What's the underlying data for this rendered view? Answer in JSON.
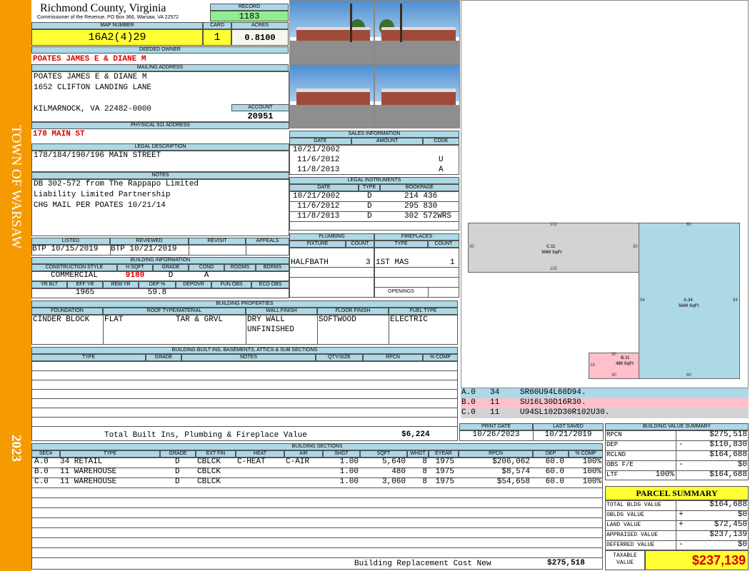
{
  "sidebar": {
    "town": "TOWN OF WARSAW",
    "year": "2023"
  },
  "header": {
    "county": "Richmond County, Virginia",
    "commissioner": "Commissioner of the Revenue, PO Box 366, Warsaw, VA 22572",
    "record_label": "RECORD",
    "record": "1183",
    "map_number_label": "MAP NUMBER",
    "map_number": "16A2(4)29",
    "card_label": "CARD",
    "card": "1",
    "acres_label": "ACRES",
    "acres": "0.8100"
  },
  "owner": {
    "label": "DEEDED OWNER",
    "name": "POATES JAMES E & DIANE M"
  },
  "mailing": {
    "label": "MAILING ADDRESS",
    "line1": "POATES JAMES E & DIANE M",
    "line2": "1652 CLIFTON LANDING LANE",
    "line3": "KILMARNOCK, VA 22482-0000",
    "account_label": "ACCOUNT",
    "account": "20951"
  },
  "physical": {
    "label": "PHYSICAL 911 ADDRESS",
    "address": "178 MAIN ST"
  },
  "legal": {
    "label": "LEGAL DESCRIPTION",
    "text": "178/184/190/196 MAIN STREET"
  },
  "notes": {
    "label": "NOTES",
    "line1": "DB 302-572 from The Rappapo Limited",
    "line2": "Liability Limited Partnership",
    "line3": "CHG MAIL PER POATES 10/21/14"
  },
  "review": {
    "listed_label": "LISTED",
    "listed": "BTP 10/15/2019",
    "reviewed_label": "REVIEWED",
    "reviewed": "BTP 10/21/2019",
    "revisit_label": "REVISIT",
    "revisit": "",
    "appeals_label": "APPEALS",
    "appeals": ""
  },
  "building_info": {
    "label": "BUILDING INFORMATION",
    "construction_style_label": "CONSTRUCTION STYLE",
    "construction_style": "COMMERCIAL",
    "h_sqft_label": "H SQFT",
    "h_sqft": "9180",
    "grade_label": "GRADE",
    "grade": "D",
    "cond_label": "COND",
    "cond": "A",
    "rooms_label": "ROOMS",
    "rooms": "",
    "bdrms_label": "BDRMS",
    "bdrms": "",
    "yr_blt_label": "YR BLT",
    "yr_blt": "",
    "eff_yr_label": "EFF YR",
    "eff_yr": "1965",
    "rem_yr_label": "REM YR",
    "rem_yr": "",
    "dep_pct_label": "DEP %",
    "dep_pct": "59.8",
    "depovr_label": "DEPOVR",
    "depovr": "",
    "fun_obs_label": "FUN OBS",
    "fun_obs": "",
    "eco_obs_label": "ECO OBS",
    "eco_obs": ""
  },
  "sales": {
    "label": "SALES INFORMATION",
    "cols": [
      "DATE",
      "AMOUNT",
      "CODE"
    ],
    "rows": [
      {
        "date": "10/21/2002",
        "amount": "",
        "code": ""
      },
      {
        "date": "11/6/2012",
        "amount": "",
        "code": "U"
      },
      {
        "date": "11/8/2013",
        "amount": "",
        "code": "A"
      }
    ]
  },
  "instruments": {
    "label": "LEGAL INSTRUMENTS",
    "cols": [
      "DATE",
      "TYPE",
      "BOOKPAGE"
    ],
    "rows": [
      {
        "date": "10/21/2002",
        "type": "D",
        "bookpage": "214 436"
      },
      {
        "date": "11/6/2012",
        "type": "D",
        "bookpage": "295 830"
      },
      {
        "date": "11/8/2013",
        "type": "D",
        "bookpage": "302 572WRS"
      }
    ]
  },
  "plumbing": {
    "label": "PLUMBING",
    "fixture_label": "FIXTURE",
    "count_label": "COUNT",
    "fixture": "HALFBATH",
    "count": "3"
  },
  "fireplaces": {
    "label": "FIREPLACES",
    "type_label": "TYPE",
    "count_label": "COUNT",
    "type": "1ST MAS",
    "count": "1",
    "openings_label": "OPENINGS",
    "openings": ""
  },
  "building_properties": {
    "label": "BUILDING PROPERTIES",
    "foundation_label": "FOUNDATION",
    "foundation": "CINDER BLOCK",
    "roof_label": "ROOF TYPE/MATERIAL",
    "roof_type": "FLAT",
    "roof_material": "TAR & GRVL",
    "wall_label": "WALL FINISH",
    "wall1": "DRY WALL",
    "wall2": "UNFINISHED",
    "floor_label": "FLOOR FINISH",
    "floor": "SOFTWOOD",
    "fuel_label": "FUEL TYPE",
    "fuel": "ELECTRIC"
  },
  "built_ins": {
    "label": "BUILDING BUILT INS, BASEMENTS, ATTICS & SUB SECTIONS",
    "cols": [
      "TYPE",
      "GRADE",
      "NOTES",
      "QTY/SIZE",
      "RPCN",
      "% COMP"
    ],
    "total_label": "Total Built Ins, Plumbing & Fireplace Value",
    "total": "$6,224"
  },
  "sketch": {
    "c_label": "C.11",
    "c_area": "3060 SqFt",
    "a_label": "A.34",
    "a_area": "5640 SqFt",
    "b_label": "B.11",
    "b_area": "480 SqFt",
    "dim_102": "102",
    "dim_30": "30",
    "dim_60": "60",
    "dim_94": "94",
    "dim_16": "16"
  },
  "sketch_codes": [
    {
      "sec": "A.0",
      "code": "34",
      "path": "SR60U94L60D94.",
      "color": "#add8e6"
    },
    {
      "sec": "B.0",
      "code": "11",
      "path": "SU16L30D16R30.",
      "color": "#ffc0cb"
    },
    {
      "sec": "C.0",
      "code": "11",
      "path": "U94SL102D30R102U30.",
      "color": "#d3d3d3"
    }
  ],
  "print_info": {
    "print_label": "PRINT DATE",
    "print_date": "10/26/2023",
    "saved_label": "LAST SAVED",
    "saved_date": "10/21/2019"
  },
  "sections": {
    "label": "BUILDING SECTIONS",
    "cols": [
      "SEC#",
      "TYPE",
      "GRADE",
      "EXT FIN",
      "HEAT",
      "AIR",
      "SHGT",
      "SQFT",
      "WHGT",
      "EYEAR",
      "RPCN",
      "DEP",
      "% COMP"
    ],
    "rows": [
      {
        "sec": "A.0",
        "type": "34 RETAIL",
        "grade": "D",
        "ext": "CBLCK",
        "heat": "C-HEAT",
        "air": "C-AIR",
        "shgt": "1.00",
        "sqft": "5,640",
        "whgt": "8",
        "eyear": "1975",
        "rpcn": "$206,062",
        "dep": "60.0",
        "comp": "100%"
      },
      {
        "sec": "B.0",
        "type": "11 WAREHOUSE",
        "grade": "D",
        "ext": "CBLCK",
        "heat": "",
        "air": "",
        "shgt": "1.00",
        "sqft": "480",
        "whgt": "8",
        "eyear": "1975",
        "rpcn": "$8,574",
        "dep": "60.0",
        "comp": "100%"
      },
      {
        "sec": "C.0",
        "type": "11 WAREHOUSE",
        "grade": "D",
        "ext": "CBLCK",
        "heat": "",
        "air": "",
        "shgt": "1.00",
        "sqft": "3,060",
        "whgt": "8",
        "eyear": "1975",
        "rpcn": "$54,658",
        "dep": "60.0",
        "comp": "100%"
      }
    ],
    "total_label": "Building Replacement Cost New",
    "total": "$275,518"
  },
  "value_summary": {
    "label": "BUILDING VALUE SUMMARY",
    "rows": [
      {
        "name": "RPCN",
        "sign": "",
        "pct": "",
        "value": "$275,518"
      },
      {
        "name": "DEP",
        "sign": "-",
        "pct": "",
        "value": "$110,830"
      },
      {
        "name": "RCLND",
        "sign": "",
        "pct": "",
        "value": "$164,688"
      },
      {
        "name": "OBS F/E",
        "sign": "-",
        "pct": "",
        "value": "$0"
      },
      {
        "name": "LTF",
        "sign": "",
        "pct": "100%",
        "value": "$164,688"
      }
    ]
  },
  "parcel_summary": {
    "label": "PARCEL SUMMARY",
    "rows": [
      {
        "name": "TOTAL BLDG VALUE",
        "sign": "",
        "value": "$164,688"
      },
      {
        "name": "OBLDG VALUE",
        "sign": "+",
        "value": "$0"
      },
      {
        "name": "LAND VALUE",
        "sign": "+",
        "value": "$72,450"
      },
      {
        "name": "APPRAISED VALUE",
        "sign": "",
        "value": "$237,139"
      },
      {
        "name": "DEFERRED VALUE",
        "sign": "-",
        "value": "$0"
      }
    ],
    "taxable_label_1": "TAXABLE",
    "taxable_label_2": "VALUE",
    "taxable": "$237,139"
  }
}
